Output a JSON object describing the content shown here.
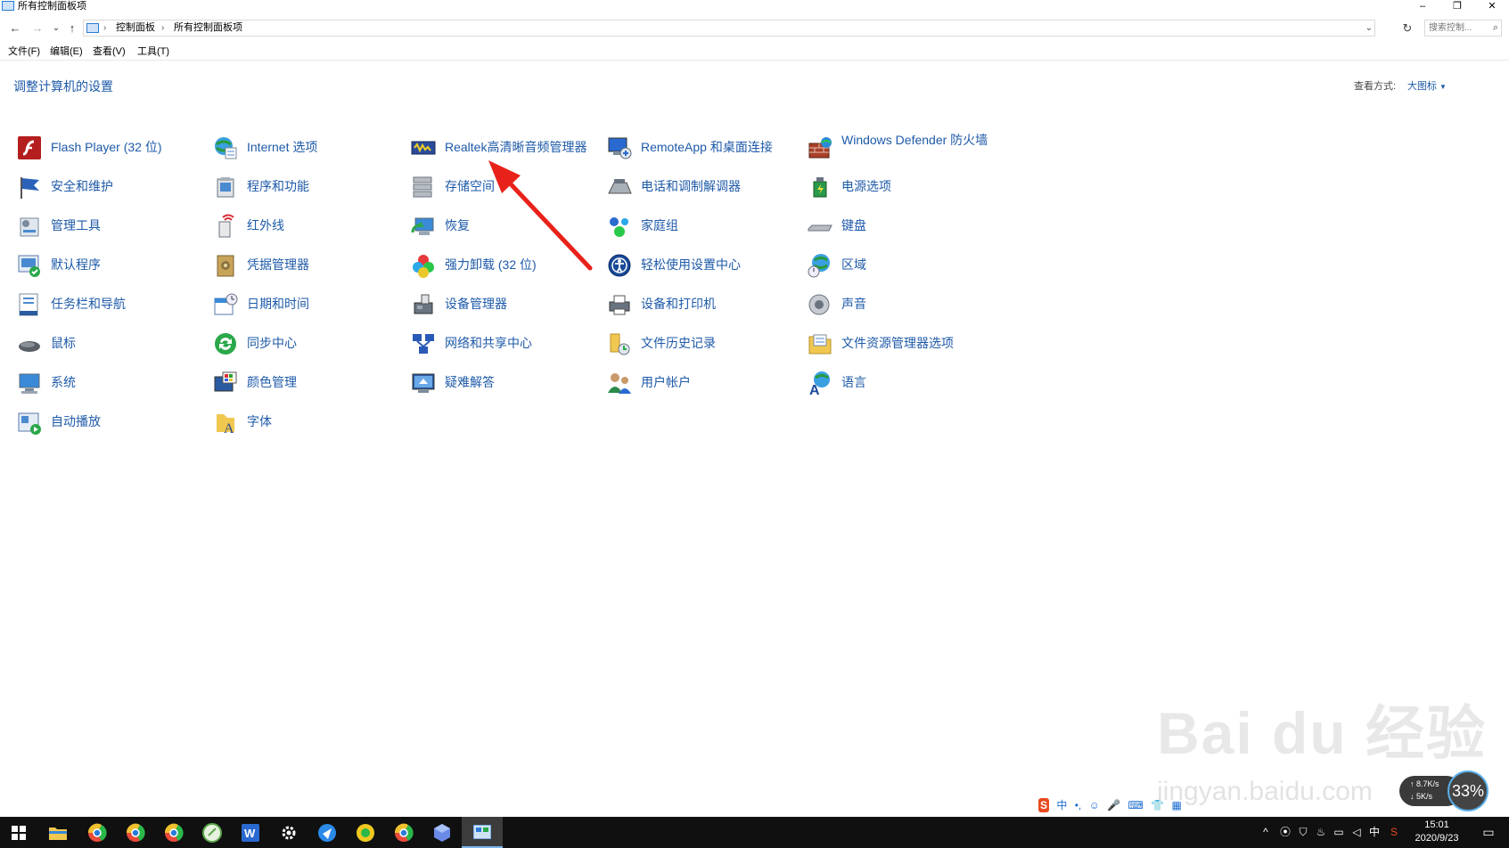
{
  "window": {
    "title": "所有控制面板项",
    "minimize": "–",
    "restore": "❐",
    "close": "✕"
  },
  "nav": {
    "back": "←",
    "forward": "→",
    "recent": "⌄",
    "up": "↑"
  },
  "address": {
    "sep": "›",
    "crumbs": [
      "控制面板",
      "所有控制面板项"
    ],
    "dropdown": "⌄",
    "refresh": "↻"
  },
  "search": {
    "placeholder": "搜索控制...",
    "icon": "⌕"
  },
  "menu": [
    "文件(F)",
    "编辑(E)",
    "查看(V)",
    "工具(T)"
  ],
  "content": {
    "heading": "调整计算机的设置",
    "view_by_label": "查看方式:",
    "view_by_value": "大图标"
  },
  "items": [
    {
      "label": "Flash Player (32 位)",
      "icon": "flash-icon"
    },
    {
      "label": "安全和维护",
      "icon": "security-flag-icon"
    },
    {
      "label": "管理工具",
      "icon": "admin-tools-icon"
    },
    {
      "label": "默认程序",
      "icon": "default-programs-icon"
    },
    {
      "label": "任务栏和导航",
      "icon": "taskbar-icon"
    },
    {
      "label": "鼠标",
      "icon": "mouse-icon"
    },
    {
      "label": "系统",
      "icon": "system-icon"
    },
    {
      "label": "自动播放",
      "icon": "autoplay-icon"
    },
    {
      "label": "Internet 选项",
      "icon": "internet-options-icon"
    },
    {
      "label": "程序和功能",
      "icon": "programs-icon"
    },
    {
      "label": "红外线",
      "icon": "infrared-icon"
    },
    {
      "label": "凭据管理器",
      "icon": "credential-icon"
    },
    {
      "label": "日期和时间",
      "icon": "date-time-icon"
    },
    {
      "label": "同步中心",
      "icon": "sync-icon"
    },
    {
      "label": "颜色管理",
      "icon": "color-icon"
    },
    {
      "label": "字体",
      "icon": "font-icon"
    },
    {
      "label": "Realtek高清晰音频管理器",
      "icon": "realtek-icon"
    },
    {
      "label": "存储空间",
      "icon": "storage-icon"
    },
    {
      "label": "恢复",
      "icon": "recovery-icon"
    },
    {
      "label": "强力卸载 (32 位)",
      "icon": "uninstall-icon"
    },
    {
      "label": "设备管理器",
      "icon": "device-manager-icon"
    },
    {
      "label": "网络和共享中心",
      "icon": "network-icon"
    },
    {
      "label": "疑难解答",
      "icon": "troubleshoot-icon"
    },
    {
      "label": "RemoteApp 和桌面连接",
      "icon": "remoteapp-icon"
    },
    {
      "label": "电话和调制解调器",
      "icon": "phone-modem-icon"
    },
    {
      "label": "家庭组",
      "icon": "homegroup-icon"
    },
    {
      "label": "轻松使用设置中心",
      "icon": "ease-of-access-icon"
    },
    {
      "label": "设备和打印机",
      "icon": "printer-icon"
    },
    {
      "label": "文件历史记录",
      "icon": "file-history-icon"
    },
    {
      "label": "用户帐户",
      "icon": "user-accounts-icon"
    },
    {
      "label": "Windows Defender 防火墙",
      "icon": "firewall-icon"
    },
    {
      "label": "电源选项",
      "icon": "power-icon"
    },
    {
      "label": "键盘",
      "icon": "keyboard-icon"
    },
    {
      "label": "区域",
      "icon": "region-icon"
    },
    {
      "label": "声音",
      "icon": "sound-icon"
    },
    {
      "label": "文件资源管理器选项",
      "icon": "folder-options-icon"
    },
    {
      "label": "语言",
      "icon": "language-icon"
    }
  ],
  "watermark": {
    "line1": "Bai du 经验",
    "line2": "jingyan.baidu.com"
  },
  "speed": {
    "up": "↑ 8.7K/s",
    "down": "↓ 5K/s",
    "percent": "33%"
  },
  "ime": {
    "logo": "S",
    "lang": "中",
    "punct": "•,",
    "emoji": "☺",
    "mic": "🎤",
    "keyboard": "⌨",
    "shirt": "👕",
    "grid": "▦"
  },
  "tray": {
    "chevron": "^",
    "ime_lang": "中",
    "time": "15:01",
    "date": "2020/9/23",
    "notify": "▭"
  },
  "colors": {
    "link": "#1e5aa8",
    "taskbar": "#101010",
    "arrow": "#e8221a"
  }
}
